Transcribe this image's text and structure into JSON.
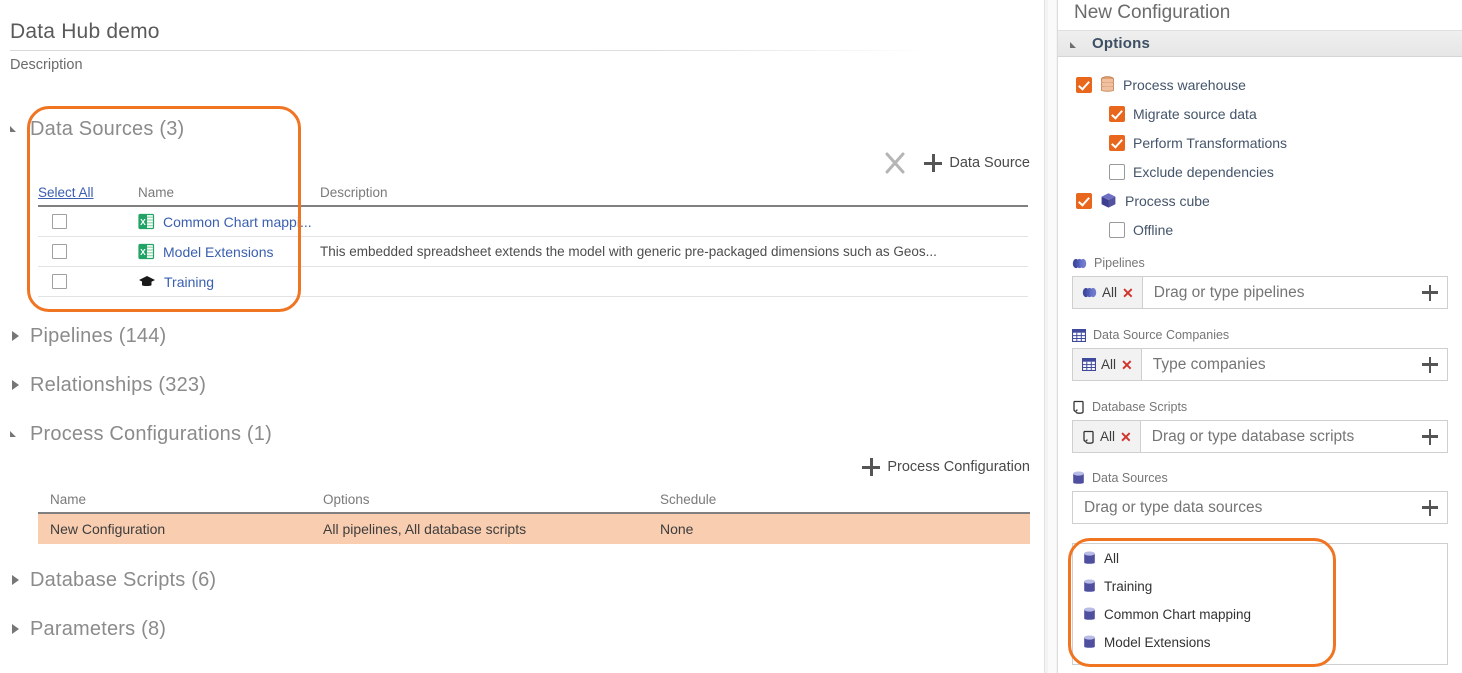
{
  "left": {
    "page_title": "Data Hub demo",
    "description_label": "Description",
    "sections": [
      {
        "label": "Data Sources (3)",
        "expanded": true
      },
      {
        "label": "Pipelines (144)",
        "expanded": false
      },
      {
        "label": "Relationships (323)",
        "expanded": false
      },
      {
        "label": "Process Configurations (1)",
        "expanded": true
      },
      {
        "label": "Database Scripts (6)",
        "expanded": false
      },
      {
        "label": "Parameters (8)",
        "expanded": false
      }
    ],
    "data_sources": {
      "toolbar": {
        "delete_icon": "x-icon",
        "add_label": "Data Source"
      },
      "columns": {
        "select_all": "Select All",
        "name": "Name",
        "description": "Description"
      },
      "rows": [
        {
          "name": "Common Chart mappi...",
          "description": "",
          "icon": "excel-icon",
          "checked": false
        },
        {
          "name": "Model Extensions",
          "description": "This embedded spreadsheet extends the model with generic pre-packaged dimensions such as Geos...",
          "icon": "excel-icon",
          "checked": false
        },
        {
          "name": "Training",
          "description": "",
          "icon": "graduation-cap-icon",
          "checked": false
        }
      ]
    },
    "process_configurations": {
      "toolbar": {
        "add_label": "Process Configuration"
      },
      "columns": {
        "name": "Name",
        "options": "Options",
        "schedule": "Schedule"
      },
      "rows": [
        {
          "name": "New Configuration",
          "options": "All pipelines, All database scripts",
          "schedule": "None",
          "selected": true
        }
      ]
    }
  },
  "right": {
    "title": "New Configuration",
    "options_header": "Options",
    "options": [
      {
        "label": "Process warehouse",
        "checked": true,
        "level": 0,
        "icon": "database-stack-icon"
      },
      {
        "label": "Migrate source data",
        "checked": true,
        "level": 1,
        "icon": ""
      },
      {
        "label": "Perform Transformations",
        "checked": true,
        "level": 1,
        "icon": ""
      },
      {
        "label": "Exclude dependencies",
        "checked": false,
        "level": 1,
        "icon": ""
      },
      {
        "label": "Process cube",
        "checked": true,
        "level": 0,
        "icon": "cube-icon"
      },
      {
        "label": "Offline",
        "checked": false,
        "level": 1,
        "icon": ""
      }
    ],
    "fields": [
      {
        "label": "Pipelines",
        "icon": "pipelines-icon",
        "chip": "All",
        "placeholder": "Drag or type pipelines"
      },
      {
        "label": "Data Source Companies",
        "icon": "grid-icon",
        "chip": "All",
        "placeholder": "Type companies"
      },
      {
        "label": "Database Scripts",
        "icon": "script-icon",
        "chip": "All",
        "placeholder": "Drag or type database scripts"
      },
      {
        "label": "Data Sources",
        "icon": "cylinder-icon",
        "chip": "",
        "placeholder": "Drag or type data sources"
      }
    ],
    "dropdown": {
      "items": [
        {
          "label": "All",
          "icon": "cylinder-icon"
        },
        {
          "label": "Training",
          "icon": "cylinder-icon"
        },
        {
          "label": "Common Chart mapping",
          "icon": "cylinder-icon"
        },
        {
          "label": "Model Extensions",
          "icon": "cylinder-icon"
        }
      ]
    }
  },
  "colors": {
    "accent_orange": "#e8671c",
    "annotation_orange": "#f07522",
    "selected_row": "#f9cdb0",
    "link_blue": "#3a5fb0",
    "excel_green": "#21a366",
    "cube_purple": "#4a4a9c"
  }
}
